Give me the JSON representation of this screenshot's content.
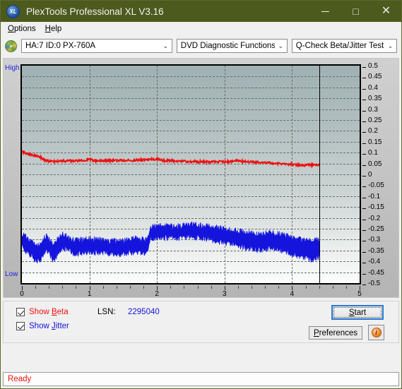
{
  "window": {
    "title": "PlexTools Professional XL V3.16",
    "icon_label": "XL",
    "minimize": "─",
    "maximize": "□",
    "close": "✕"
  },
  "menu": {
    "items": [
      {
        "label": "Options",
        "accel": "O"
      },
      {
        "label": "Help",
        "accel": "H"
      }
    ]
  },
  "toolbar": {
    "drive": "HA:7 ID:0  PX-760A",
    "function": "DVD Diagnostic Functions",
    "test": "Q-Check Beta/Jitter Test",
    "arrow": "⌄"
  },
  "options": {
    "show_beta": "Show Beta",
    "show_jitter": "Show Jitter",
    "show_beta_checked": true,
    "show_jitter_checked": true,
    "lsn_label": "LSN:",
    "lsn_value": "2295040",
    "start": "Start",
    "preferences": "Preferences",
    "info": "i"
  },
  "status": {
    "text": "Ready"
  },
  "colors": {
    "title_bar": "#4c5a1e",
    "beta_line": "#ee1111",
    "jitter_band": "#1414dd",
    "plot_top": "#9fb1b3",
    "plot_bottom": "#fbfcfb",
    "status_text": "#ee1111",
    "start_focus": "#1d6fd0"
  },
  "chart_data": {
    "type": "line",
    "title": "Q-Check Beta/Jitter Test",
    "xlabel": "",
    "ylabel": "",
    "xlim": [
      0,
      5
    ],
    "ylim": [
      -0.5,
      0.5
    ],
    "grid": true,
    "legend_position": "bottom-left",
    "y_ticks": [
      0.5,
      0.45,
      0.4,
      0.35,
      0.3,
      0.25,
      0.2,
      0.15,
      0.1,
      0.05,
      0,
      -0.05,
      -0.1,
      -0.15,
      -0.2,
      -0.25,
      -0.3,
      -0.35,
      -0.4,
      -0.45,
      -0.5
    ],
    "x_ticks": [
      0,
      1,
      2,
      3,
      4,
      5
    ],
    "axis_labels": {
      "high": "High",
      "low": "Low"
    },
    "data_end_x": 4.4,
    "marker_line_x": 4.4,
    "series": [
      {
        "name": "Beta",
        "color": "#ee1111",
        "type": "line",
        "x": [
          0.0,
          0.05,
          0.1,
          0.15,
          0.2,
          0.25,
          0.3,
          0.35,
          0.4,
          0.5,
          0.6,
          0.7,
          0.8,
          0.9,
          1.0,
          1.1,
          1.2,
          1.3,
          1.4,
          1.5,
          1.6,
          1.7,
          1.8,
          1.9,
          2.0,
          2.1,
          2.2,
          2.3,
          2.4,
          2.5,
          2.6,
          2.7,
          2.8,
          2.9,
          3.0,
          3.1,
          3.2,
          3.3,
          3.4,
          3.5,
          3.6,
          3.7,
          3.8,
          3.9,
          4.0,
          4.1,
          4.2,
          4.3,
          4.4
        ],
        "values": [
          0.105,
          0.098,
          0.092,
          0.088,
          0.085,
          0.083,
          0.074,
          0.063,
          0.06,
          0.058,
          0.062,
          0.062,
          0.063,
          0.064,
          0.07,
          0.061,
          0.063,
          0.064,
          0.064,
          0.065,
          0.064,
          0.066,
          0.066,
          0.069,
          0.07,
          0.064,
          0.062,
          0.061,
          0.06,
          0.059,
          0.058,
          0.058,
          0.058,
          0.058,
          0.058,
          0.059,
          0.063,
          0.059,
          0.057,
          0.056,
          0.054,
          0.052,
          0.05,
          0.048,
          0.046,
          0.043,
          0.042,
          0.044,
          0.043
        ]
      },
      {
        "name": "Jitter",
        "color": "#1414dd",
        "type": "band",
        "x": [
          0.0,
          0.05,
          0.1,
          0.15,
          0.2,
          0.25,
          0.3,
          0.35,
          0.4,
          0.45,
          0.5,
          0.55,
          0.6,
          0.65,
          0.7,
          0.75,
          0.8,
          0.85,
          0.9,
          0.95,
          1.0,
          1.1,
          1.2,
          1.3,
          1.4,
          1.5,
          1.6,
          1.7,
          1.75,
          1.8,
          1.85,
          1.9,
          2.0,
          2.1,
          2.2,
          2.3,
          2.4,
          2.5,
          2.6,
          2.7,
          2.8,
          2.9,
          3.0,
          3.1,
          3.2,
          3.3,
          3.4,
          3.5,
          3.6,
          3.7,
          3.8,
          3.9,
          4.0,
          4.1,
          4.2,
          4.3,
          4.4
        ],
        "upper": [
          -0.27,
          -0.278,
          -0.3,
          -0.302,
          -0.318,
          -0.33,
          -0.31,
          -0.282,
          -0.29,
          -0.322,
          -0.316,
          -0.288,
          -0.276,
          -0.278,
          -0.29,
          -0.3,
          -0.302,
          -0.304,
          -0.3,
          -0.298,
          -0.296,
          -0.3,
          -0.302,
          -0.306,
          -0.308,
          -0.306,
          -0.3,
          -0.296,
          -0.296,
          -0.3,
          -0.298,
          -0.244,
          -0.236,
          -0.24,
          -0.238,
          -0.24,
          -0.236,
          -0.232,
          -0.234,
          -0.236,
          -0.242,
          -0.248,
          -0.252,
          -0.258,
          -0.262,
          -0.266,
          -0.272,
          -0.276,
          -0.272,
          -0.268,
          -0.274,
          -0.282,
          -0.29,
          -0.296,
          -0.302,
          -0.308,
          -0.3
        ],
        "lower": [
          -0.33,
          -0.348,
          -0.368,
          -0.372,
          -0.392,
          -0.405,
          -0.38,
          -0.344,
          -0.352,
          -0.392,
          -0.386,
          -0.352,
          -0.338,
          -0.342,
          -0.352,
          -0.36,
          -0.362,
          -0.364,
          -0.36,
          -0.358,
          -0.356,
          -0.36,
          -0.362,
          -0.366,
          -0.368,
          -0.366,
          -0.36,
          -0.356,
          -0.356,
          -0.36,
          -0.358,
          -0.296,
          -0.288,
          -0.292,
          -0.29,
          -0.292,
          -0.288,
          -0.284,
          -0.288,
          -0.292,
          -0.3,
          -0.308,
          -0.314,
          -0.322,
          -0.328,
          -0.334,
          -0.342,
          -0.348,
          -0.342,
          -0.336,
          -0.344,
          -0.356,
          -0.366,
          -0.374,
          -0.382,
          -0.392,
          -0.38
        ]
      }
    ]
  }
}
